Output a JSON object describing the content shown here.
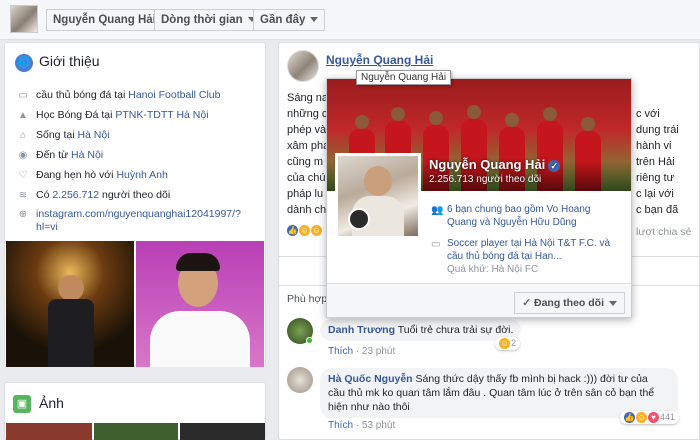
{
  "topbar": {
    "name_button": "Nguyễn Quang Hải",
    "timeline_button": "Dòng thời gian",
    "recent_button": "Gần đây"
  },
  "intro": {
    "title": "Giới thiệu",
    "items": [
      {
        "prefix": "cầu thủ bóng đá tại ",
        "link": "Hanoi Football Club",
        "icon": "briefcase-icon"
      },
      {
        "prefix": "Học Bóng Đá tại ",
        "link": "PTNK-TDTT Hà Nội",
        "icon": "graduation-cap-icon"
      },
      {
        "prefix": "Sống tại ",
        "link": "Hà Nội",
        "icon": "home-icon"
      },
      {
        "prefix": "Đến từ ",
        "link": "Hà Nội",
        "icon": "location-pin-icon"
      },
      {
        "prefix": "Đang hẹn hò với ",
        "link": "Huỳnh Anh",
        "icon": "heart-icon"
      },
      {
        "prefix": "Có ",
        "link": "2.256.712",
        "suffix": " người theo dõi",
        "icon": "rss-icon"
      },
      {
        "prefix": "",
        "link": "instagram.com/nguyenquanghai12041997/?",
        "link2": "hl=vi",
        "icon": "globe-icon"
      }
    ]
  },
  "photos_section": {
    "title": "Ảnh"
  },
  "post": {
    "author": "Nguyễn Quang Hải",
    "tooltip": "Nguyễn Quang Hải",
    "left_text": [
      "Sáng na",
      "những c",
      "phép và",
      "xâm pha",
      "cũng m",
      "của chú",
      "pháp lu",
      "dành ch"
    ],
    "right_text": [
      "c với",
      "dụng trái",
      "hành vi",
      "trên Hải",
      "riêng tư",
      "c lại với",
      "c bạn đã"
    ],
    "share_tail": "lượt chia sẻ",
    "comments_label": "Phù hợp"
  },
  "hovercard": {
    "name": "Nguyễn Quang Hải",
    "followers": "2.256.713 người theo dõi",
    "mutual_friends": "6 bạn chung bao gồm Vo Hoang Quang và Nguyễn Hữu Dũng",
    "work": "Soccer player tại Hà Nội T&T F.C. và cầu thủ bóng đá tại Han...",
    "past": "Quá khứ: Hà Nội FC",
    "follow_button": "Đang theo dõi"
  },
  "comments": [
    {
      "author": "Danh Trương",
      "text": "Tuổi trẻ chưa trải sự đời.",
      "like": "Thích",
      "time": "23 phút",
      "reaction_count": "2"
    },
    {
      "author": "Hà Quốc Nguyễn",
      "text_lines": [
        "Sáng thức dậy thấy fb mình bị hack :))) đời tư của",
        "cầu thủ mk ko quan tâm lắm đâu . Quan tâm lúc ở trên sân cỏ bạn thể",
        "hiện như nào thôi"
      ],
      "like": "Thích",
      "time": "53 phút",
      "reaction_count": "441"
    }
  ]
}
